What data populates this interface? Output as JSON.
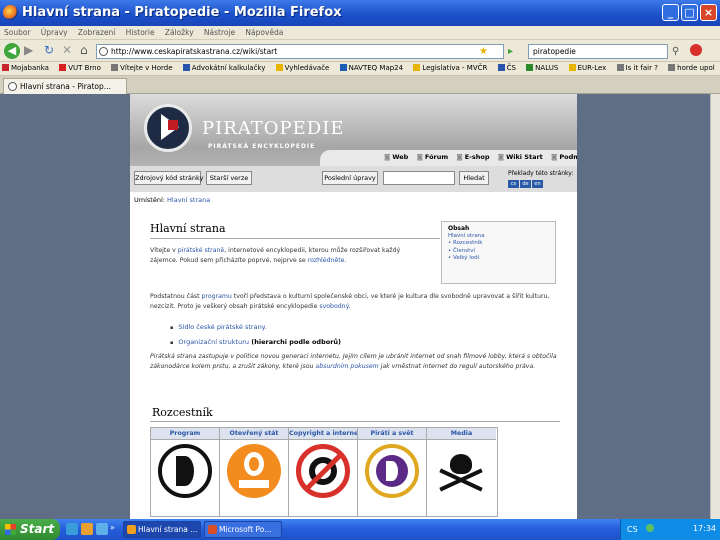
{
  "window": {
    "title": "Hlavní strana - Piratopedie - Mozilla Firefox"
  },
  "menu": [
    "Soubor",
    "Úpravy",
    "Zobrazení",
    "Historie",
    "Záložky",
    "Nástroje",
    "Nápověda"
  ],
  "nav": {
    "url": "http://www.ceskapiratskastrana.cz/wiki/start",
    "search": "piratopedie"
  },
  "bookmarks": [
    "Mojabanka",
    "VUT Brno",
    "Vítejte v Horde",
    "Advokátní kalkulačky",
    "Vyhledávače",
    "NAVTEQ Map24",
    "Legislativa - MVČR",
    "ČS",
    "NALUS",
    "EUR-Lex",
    "Is it fair ?",
    "horde upol"
  ],
  "tab": {
    "label": "Hlavní strana - Piratop..."
  },
  "site": {
    "title": "PIRATOPEDIE",
    "subtitle": "PIRÁTSKÁ ENCYKLOPEDIE",
    "topnav": [
      "Web",
      "Fórum",
      "E-shop",
      "Wiki Start",
      "Podmínky"
    ],
    "buttons": {
      "source": "Zdrojový kód stránky",
      "old": "Starší verze",
      "recent": "Poslední úpravy",
      "search": "Hledat"
    },
    "recent_label": "Překlady této stránky:",
    "langs": [
      "cs",
      "de",
      "en"
    ],
    "breadcrumb_label": "Umístění:",
    "breadcrumb_link": "Hlavní strana"
  },
  "article": {
    "heading": "Hlavní strana",
    "p1_a": "Vítejte v ",
    "p1_link": "pirátské straně",
    "p1_b": ", internetové encyklopedii, kterou může rozšiřovat každý zájemce. Pokud sem přicházíte poprvé, nejprve se ",
    "p1_link2": "rozhlédněte",
    "p1_c": ".",
    "p2_a": "Podstatnou část ",
    "p2_link": "programu",
    "p2_b": " tvoří představa o kulturní společenské obci, ve které je kultura dle svobodně upravovat a šířit kulturu, nezcizit. Proto je veškerý obsah pirátské encyklopedie ",
    "p2_link2": "svobodný",
    "p2_c": ".",
    "list": [
      {
        "text": "Sídlo české pirátské strany."
      },
      {
        "text": "Organizační strukturu",
        "bold": " (hierarchi podle odborů)"
      }
    ],
    "p3_a": "Pirátská strana zastupuje v politice novou generaci internetu. Jejím cílem je ubránit internet od snah filmové lobby, která s obtočila zákonodárce kolem prstu, a zrušit zákony, které jsou ",
    "p3_link": "absurdním pokusem",
    "p3_b": " jak vměstnat internet do regulí autorského práva.",
    "toc_title": "Obsah",
    "toc": [
      "Hlavní strana",
      "• Rozcestník",
      "• Členství",
      "• Velký lodí"
    ]
  },
  "rozcestnik": {
    "heading": "Rozcestník",
    "columns": [
      "Program",
      "Otevřený stát",
      "Copyright a internet",
      "Piráti a svět",
      "Media"
    ]
  },
  "taskbar": {
    "start": "Start",
    "tasks": [
      "Hlavní strana ...",
      "Microsoft Po..."
    ],
    "lang": "CS",
    "clock": "17:34"
  }
}
